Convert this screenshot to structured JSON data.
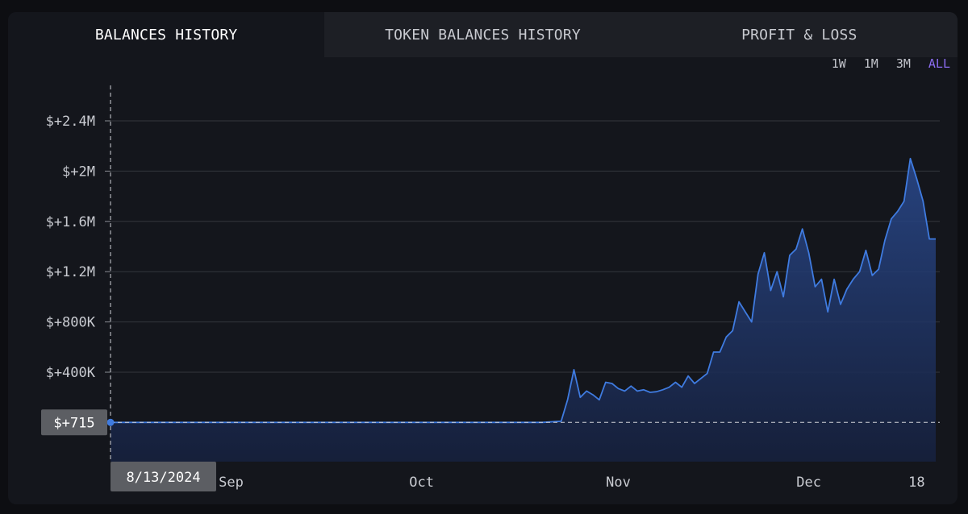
{
  "tabs": [
    {
      "label": "BALANCES HISTORY",
      "active": true
    },
    {
      "label": "TOKEN BALANCES HISTORY",
      "active": false
    },
    {
      "label": "PROFIT & LOSS",
      "active": false
    }
  ],
  "ranges": [
    {
      "label": "1W",
      "active": false
    },
    {
      "label": "1M",
      "active": false
    },
    {
      "label": "3M",
      "active": false
    },
    {
      "label": "ALL",
      "active": true
    }
  ],
  "colors": {
    "background": "#14161c",
    "line": "#3f7be0",
    "area_top": "#2a4a8f",
    "area_bottom": "#16213f",
    "accent": "#8b6cf0",
    "grid": "#33363d"
  },
  "chart_data": {
    "type": "area",
    "title": "",
    "xlabel": "",
    "ylabel": "",
    "ylim": [
      -300000,
      2700000
    ],
    "y_ticks": [
      {
        "value": 400000,
        "label": "$+400K"
      },
      {
        "value": 800000,
        "label": "$+800K"
      },
      {
        "value": 1200000,
        "label": "$+1.2M"
      },
      {
        "value": 1600000,
        "label": "$+1.6M"
      },
      {
        "value": 2000000,
        "label": "$+2M"
      },
      {
        "value": 2400000,
        "label": "$+2.4M"
      }
    ],
    "x_ticks": [
      {
        "value": "2024-09-01",
        "label": "Sep"
      },
      {
        "value": "2024-10-01",
        "label": "Oct"
      },
      {
        "value": "2024-11-01",
        "label": "Nov"
      },
      {
        "value": "2024-12-01",
        "label": "Dec"
      },
      {
        "value": "2024-12-18",
        "label": "18"
      }
    ],
    "xlim": [
      "2024-08-13",
      "2024-12-21"
    ],
    "crosshair": {
      "date_label": "8/13/2024",
      "value_label": "$+715",
      "value": 715
    },
    "grid": true,
    "series": [
      {
        "points": [
          [
            "2024-08-13",
            715
          ],
          [
            "2024-10-20",
            715
          ],
          [
            "2024-10-23",
            10000
          ],
          [
            "2024-10-24",
            180000
          ],
          [
            "2024-10-25",
            420000
          ],
          [
            "2024-10-26",
            200000
          ],
          [
            "2024-10-27",
            250000
          ],
          [
            "2024-10-28",
            220000
          ],
          [
            "2024-10-29",
            180000
          ],
          [
            "2024-10-30",
            320000
          ],
          [
            "2024-10-31",
            310000
          ],
          [
            "2024-11-01",
            270000
          ],
          [
            "2024-11-02",
            250000
          ],
          [
            "2024-11-03",
            290000
          ],
          [
            "2024-11-04",
            250000
          ],
          [
            "2024-11-05",
            260000
          ],
          [
            "2024-11-06",
            240000
          ],
          [
            "2024-11-07",
            245000
          ],
          [
            "2024-11-08",
            260000
          ],
          [
            "2024-11-09",
            280000
          ],
          [
            "2024-11-10",
            320000
          ],
          [
            "2024-11-11",
            280000
          ],
          [
            "2024-11-12",
            370000
          ],
          [
            "2024-11-13",
            310000
          ],
          [
            "2024-11-14",
            350000
          ],
          [
            "2024-11-15",
            390000
          ],
          [
            "2024-11-16",
            560000
          ],
          [
            "2024-11-17",
            560000
          ],
          [
            "2024-11-18",
            680000
          ],
          [
            "2024-11-19",
            730000
          ],
          [
            "2024-11-20",
            960000
          ],
          [
            "2024-11-21",
            880000
          ],
          [
            "2024-11-22",
            800000
          ],
          [
            "2024-11-23",
            1180000
          ],
          [
            "2024-11-24",
            1350000
          ],
          [
            "2024-11-25",
            1050000
          ],
          [
            "2024-11-26",
            1200000
          ],
          [
            "2024-11-27",
            1000000
          ],
          [
            "2024-11-28",
            1330000
          ],
          [
            "2024-11-29",
            1380000
          ],
          [
            "2024-11-30",
            1540000
          ],
          [
            "2024-12-01",
            1350000
          ],
          [
            "2024-12-02",
            1080000
          ],
          [
            "2024-12-03",
            1140000
          ],
          [
            "2024-12-04",
            880000
          ],
          [
            "2024-12-05",
            1140000
          ],
          [
            "2024-12-06",
            940000
          ],
          [
            "2024-12-07",
            1060000
          ],
          [
            "2024-12-08",
            1140000
          ],
          [
            "2024-12-09",
            1200000
          ],
          [
            "2024-12-10",
            1370000
          ],
          [
            "2024-12-11",
            1170000
          ],
          [
            "2024-12-12",
            1220000
          ],
          [
            "2024-12-13",
            1450000
          ],
          [
            "2024-12-14",
            1620000
          ],
          [
            "2024-12-15",
            1680000
          ],
          [
            "2024-12-16",
            1760000
          ],
          [
            "2024-12-17",
            2100000
          ],
          [
            "2024-12-18",
            1940000
          ],
          [
            "2024-12-19",
            1760000
          ],
          [
            "2024-12-20",
            1460000
          ],
          [
            "2024-12-21",
            1460000
          ]
        ]
      }
    ]
  }
}
